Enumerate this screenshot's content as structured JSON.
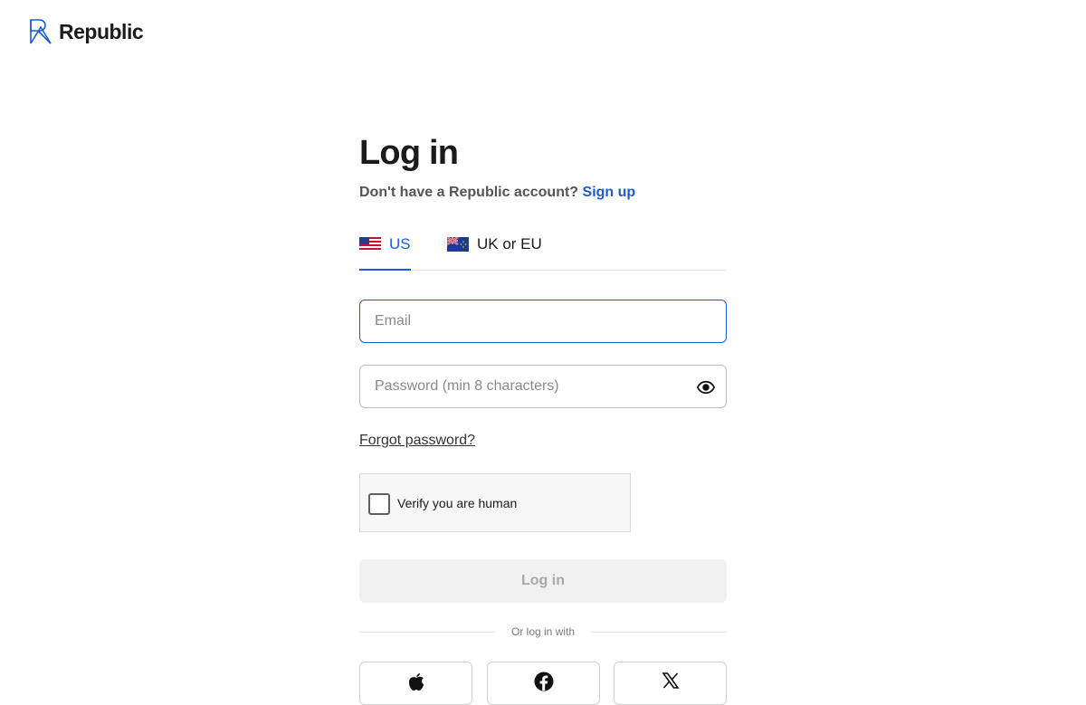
{
  "brand": {
    "name": "Republic",
    "logo_icon": "republic-logo-icon"
  },
  "login": {
    "title": "Log in",
    "subtitle_prefix": "Don't have a Republic account?",
    "signup_link": "Sign up"
  },
  "tabs": [
    {
      "label": "US",
      "flag": "us-flag-icon",
      "active": true
    },
    {
      "label": "UK or EU",
      "flag": "uk-eu-flag-icon",
      "active": false
    }
  ],
  "fields": {
    "email": {
      "placeholder": "Email",
      "value": ""
    },
    "password": {
      "placeholder": "Password (min 8 characters)",
      "value": "",
      "toggle_icon": "eye-icon"
    }
  },
  "forgot_password": "Forgot password?",
  "captcha": {
    "label": "Verify you are human",
    "checked": false
  },
  "login_button": "Log in",
  "divider_text": "Or log in with",
  "social_buttons": [
    {
      "icon": "apple-icon"
    },
    {
      "icon": "facebook-icon"
    },
    {
      "icon": "x-icon"
    }
  ],
  "colors": {
    "accent": "#1d5bd1",
    "disabled_bg": "#f1f1f1",
    "disabled_text": "#a8a8a8"
  }
}
